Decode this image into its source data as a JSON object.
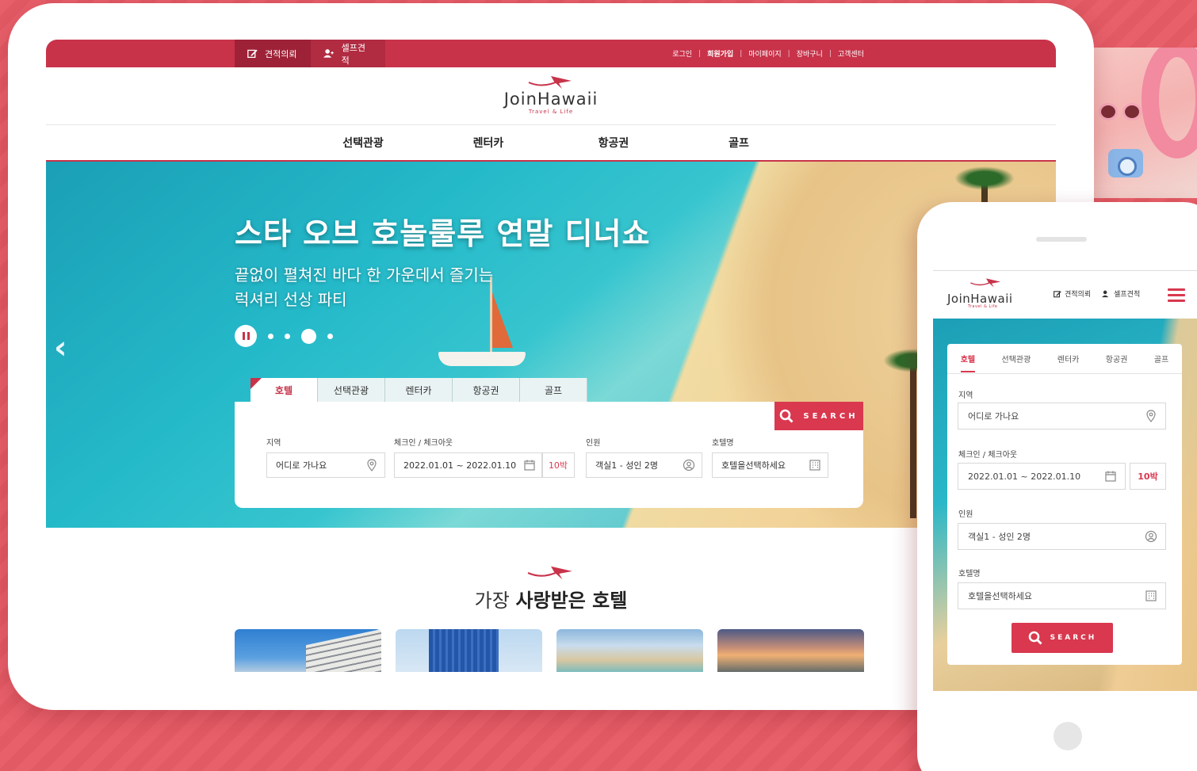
{
  "colors": {
    "accent": "#c8334a",
    "button": "#d9384f",
    "background": "#e8606a"
  },
  "topbar": {
    "quote_request": "견적의뢰",
    "self_quote": "셀프견적",
    "links": [
      "로그인",
      "회원가입",
      "마이페이지",
      "장바구니",
      "고객센터"
    ]
  },
  "logo": {
    "name": "JoinHawaii",
    "sub": "Travel & Life"
  },
  "nav": [
    "선택관광",
    "렌터카",
    "항공권",
    "골프"
  ],
  "hero": {
    "title": "스타 오브 호놀룰루 연말 디너쇼",
    "subtitle_line1": "끝없이 펼쳐진 바다 한 가운데서  즐기는",
    "subtitle_line2": "럭셔리 선상 파티",
    "slides": 4,
    "active_slide": 3
  },
  "search": {
    "tabs": [
      "호텔",
      "선택관광",
      "렌터카",
      "항공권",
      "골프"
    ],
    "active_tab": "호텔",
    "button": "SEARCH",
    "region_label": "지역",
    "region_placeholder": "어디로 가나요",
    "dates_label": "체크인 / 체크아웃",
    "dates_value": "2022.01.01  ~  2022.01.10",
    "nights": "10박",
    "guests_label": "인원",
    "guests_value": "객실1 - 성인 2명",
    "hotel_label": "호텔명",
    "hotel_placeholder": "호텔을선택하세요"
  },
  "loved": {
    "title_light": "가장",
    "title_bold": "사랑받은 호텔"
  },
  "mobile": {
    "quote_request": "견적의뢰",
    "self_quote": "셀프견적",
    "guests_value": "객실1 - 성인 2명"
  }
}
